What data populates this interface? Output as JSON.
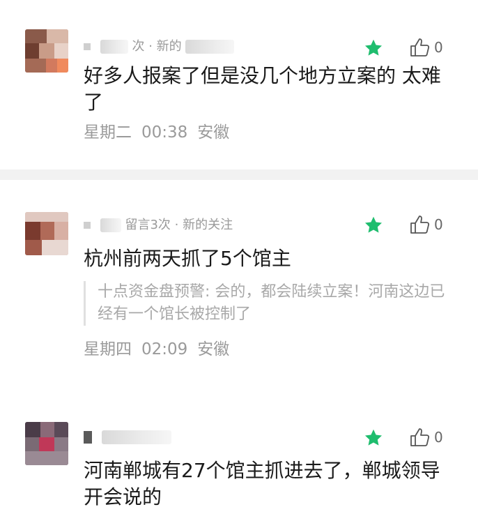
{
  "colors": {
    "star": "#1fbd6e",
    "meta_text": "#9a9a9a",
    "body_text": "#1a1a1a",
    "quote_text": "#a8a8a8",
    "separator": "#f2f2f2"
  },
  "icons": {
    "favorite": "star-icon",
    "like": "thumbs-up-icon"
  },
  "comments": [
    {
      "meta": "次 · 新的",
      "like_count": "0",
      "body": "好多人报案了但是没几个地方立案的 太难了",
      "day": "星期二",
      "time": "00:38",
      "location": "安徽"
    },
    {
      "meta": "留言3次 · 新的关注",
      "like_count": "0",
      "body": "杭州前两天抓了5个馆主",
      "quote": "十点资金盘预警: 会的，都会陆续立案！河南这边已经有一个馆长被控制了",
      "day": "星期四",
      "time": "02:09",
      "location": "安徽"
    },
    {
      "meta": "",
      "like_count": "0",
      "body": "河南郸城有27个馆主抓进去了，郸城领导开会说的"
    }
  ]
}
